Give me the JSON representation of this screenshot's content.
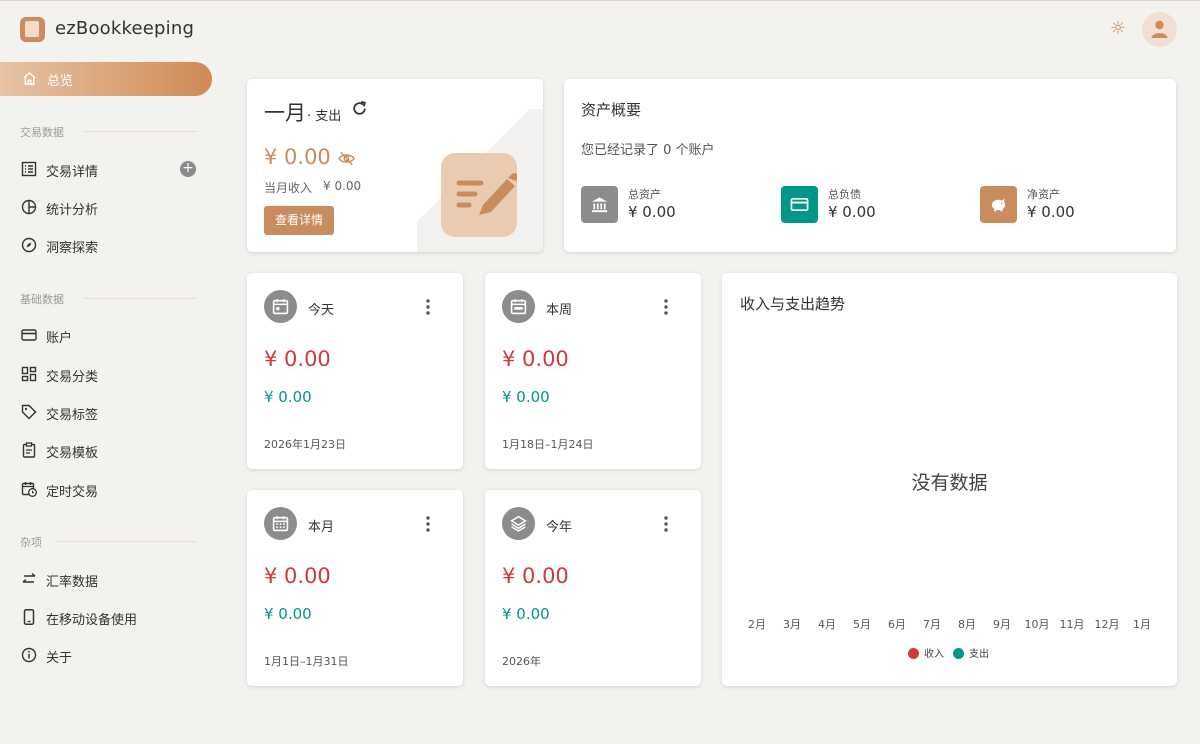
{
  "app": {
    "title": "ezBookkeeping"
  },
  "sidebar": {
    "active": "总览",
    "sections": [
      {
        "label": "交易数据",
        "items": [
          "交易详情",
          "统计分析",
          "洞察探索"
        ]
      },
      {
        "label": "基础数据",
        "items": [
          "账户",
          "交易分类",
          "交易标签",
          "交易模板",
          "定时交易"
        ]
      },
      {
        "label": "杂项",
        "items": [
          "汇率数据",
          "在移动设备使用",
          "关于"
        ]
      }
    ],
    "icons": [
      "home-icon",
      "list-icon",
      "pie-chart-icon",
      "compass-icon",
      "credit-card-icon",
      "grid-icon",
      "tag-icon",
      "clipboard-icon",
      "calendar-clock-icon",
      "swap-icon",
      "phone-icon",
      "info-icon"
    ]
  },
  "month_card": {
    "title": "一月",
    "subtitle": "· 支出",
    "amount": "¥ 0.00",
    "income_label": "当月收入",
    "income_value": "¥ 0.00",
    "button": "查看详情"
  },
  "asset_card": {
    "title": "资产概要",
    "description": "您已经记录了 0 个账户",
    "items": [
      {
        "label": "总资产",
        "value": "¥ 0.00",
        "color": "#8c8c8c",
        "icon": "bank-icon"
      },
      {
        "label": "总负债",
        "value": "¥ 0.00",
        "color": "#009688",
        "icon": "credit-card-icon"
      },
      {
        "label": "净资产",
        "value": "¥ 0.00",
        "color": "#c98c5e",
        "icon": "piggy-bank-icon"
      }
    ]
  },
  "periods": [
    {
      "name": "今天",
      "expense": "¥ 0.00",
      "income": "¥ 0.00",
      "date": "2026年1月23日",
      "icon": "calendar-today-icon"
    },
    {
      "name": "本周",
      "expense": "¥ 0.00",
      "income": "¥ 0.00",
      "date": "1月18日–1月24日",
      "icon": "calendar-week-icon"
    },
    {
      "name": "本月",
      "expense": "¥ 0.00",
      "income": "¥ 0.00",
      "date": "1月1日–1月31日",
      "icon": "calendar-month-icon"
    },
    {
      "name": "今年",
      "expense": "¥ 0.00",
      "income": "¥ 0.00",
      "date": "2026年",
      "icon": "layers-icon"
    }
  ],
  "trend_card": {
    "title": "收入与支出趋势",
    "empty_text": "没有数据",
    "months": [
      "2月",
      "3月",
      "4月",
      "5月",
      "6月",
      "7月",
      "8月",
      "9月",
      "10月",
      "11月",
      "12月",
      "1月"
    ],
    "legend": [
      {
        "label": "收入",
        "color": "#d0393e"
      },
      {
        "label": "支出",
        "color": "#009688"
      }
    ]
  },
  "colors": {
    "accent": "#c98c5e",
    "expense": "#d0393e",
    "income": "#009688",
    "background": "#f4f2ef"
  }
}
